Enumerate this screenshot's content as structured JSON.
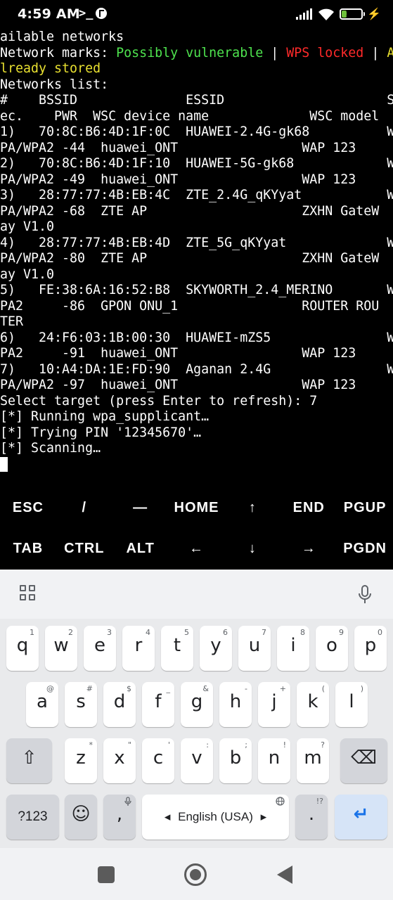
{
  "status_bar": {
    "time": "4:59 AM",
    "prompt_glyph": ">_",
    "battery": "24",
    "bolt": "⚡",
    "signal_icon": "signal-icon",
    "wifi_icon": "wifi-icon"
  },
  "terminal": {
    "lines": [
      [
        {
          "t": "ailable networks"
        }
      ],
      [
        {
          "t": "Network marks: "
        },
        {
          "t": "Possibly vulnerable",
          "c": "green"
        },
        {
          "t": " | "
        },
        {
          "t": "WPS locked",
          "c": "red"
        },
        {
          "t": " | "
        },
        {
          "t": "A",
          "c": "yellow"
        }
      ],
      [
        {
          "t": "lready stored",
          "c": "yellow"
        }
      ],
      [
        {
          "t": "Networks list:"
        }
      ],
      [
        {
          "t": "#    BSSID              ESSID                     S"
        }
      ],
      [
        {
          "t": "ec.    PWR  WSC device name             WSC model"
        }
      ],
      [
        {
          "t": "1)   70:8C:B6:4D:1F:0C  HUAWEI-2.4G-gk68          W"
        }
      ],
      [
        {
          "t": "PA/WPA2 -44  huawei_ONT                WAP 123"
        }
      ],
      [
        {
          "t": "2)   70:8C:B6:4D:1F:10  HUAWEI-5G-gk68            W"
        }
      ],
      [
        {
          "t": "PA/WPA2 -49  huawei_ONT                WAP 123"
        }
      ],
      [
        {
          "t": "3)   28:77:77:4B:EB:4C  ZTE_2.4G_qKYyat           W"
        }
      ],
      [
        {
          "t": "PA/WPA2 -68  ZTE AP                    ZXHN GateW"
        }
      ],
      [
        {
          "t": "ay V1.0"
        }
      ],
      [
        {
          "t": "4)   28:77:77:4B:EB:4D  ZTE_5G_qKYyat             W"
        }
      ],
      [
        {
          "t": "PA/WPA2 -80  ZTE AP                    ZXHN GateW"
        }
      ],
      [
        {
          "t": "ay V1.0"
        }
      ],
      [
        {
          "t": "5)   FE:38:6A:16:52:B8  SKYWORTH_2.4_MERINO       W"
        }
      ],
      [
        {
          "t": "PA2     -86  GPON ONU_1                ROUTER ROU"
        }
      ],
      [
        {
          "t": "TER"
        }
      ],
      [
        {
          "t": "6)   24:F6:03:1B:00:30  HUAWEI-mZS5               W"
        }
      ],
      [
        {
          "t": "PA2     -91  huawei_ONT                WAP 123"
        }
      ],
      [
        {
          "t": "7)   10:A4:DA:1E:FD:90  Aganan 2.4G               W"
        }
      ],
      [
        {
          "t": "PA/WPA2 -97  huawei_ONT                WAP 123"
        }
      ],
      [
        {
          "t": "Select target (press Enter to refresh): 7"
        }
      ],
      [
        {
          "t": "[*] Running wpa_supplicant…"
        }
      ],
      [
        {
          "t": "[*] Trying PIN '12345670'…"
        }
      ],
      [
        {
          "t": "[*] Scanning…"
        }
      ]
    ]
  },
  "extra_keys": {
    "row1": [
      "ESC",
      "/",
      "—",
      "HOME",
      "↑",
      "END",
      "PGUP"
    ],
    "row2": [
      "TAB",
      "CTRL",
      "ALT",
      "←",
      "↓",
      "→",
      "PGDN"
    ]
  },
  "keyboard": {
    "row1": [
      [
        "q",
        "1"
      ],
      [
        "w",
        "2"
      ],
      [
        "e",
        "3"
      ],
      [
        "r",
        "4"
      ],
      [
        "t",
        "5"
      ],
      [
        "y",
        "6"
      ],
      [
        "u",
        "7"
      ],
      [
        "i",
        "8"
      ],
      [
        "o",
        "9"
      ],
      [
        "p",
        "0"
      ]
    ],
    "row2": [
      [
        "a",
        "@"
      ],
      [
        "s",
        "#"
      ],
      [
        "d",
        "$"
      ],
      [
        "f",
        "_"
      ],
      [
        "g",
        "&"
      ],
      [
        "h",
        "-"
      ],
      [
        "j",
        "+"
      ],
      [
        "k",
        "("
      ],
      [
        "l",
        ")"
      ]
    ],
    "row3": [
      [
        "z",
        "*"
      ],
      [
        "x",
        "\""
      ],
      [
        "c",
        "'"
      ],
      [
        "v",
        ":"
      ],
      [
        "b",
        ";"
      ],
      [
        "n",
        "!"
      ],
      [
        "m",
        "?"
      ]
    ],
    "shift_glyph": "⇧",
    "backspace_glyph": "⌫",
    "symbols_label": "?123",
    "emoji_glyph": "☺",
    "comma": ",",
    "space_label": "English (USA)",
    "space_left": "◂",
    "space_right": "▸",
    "period": ".",
    "period_hint": "!?",
    "enter_glyph": "↵"
  },
  "colors": {
    "vulnerable": "#4ee34e",
    "locked": "#ff2a2a",
    "stored": "#e8e030",
    "enter_accent": "#1a73e8"
  }
}
